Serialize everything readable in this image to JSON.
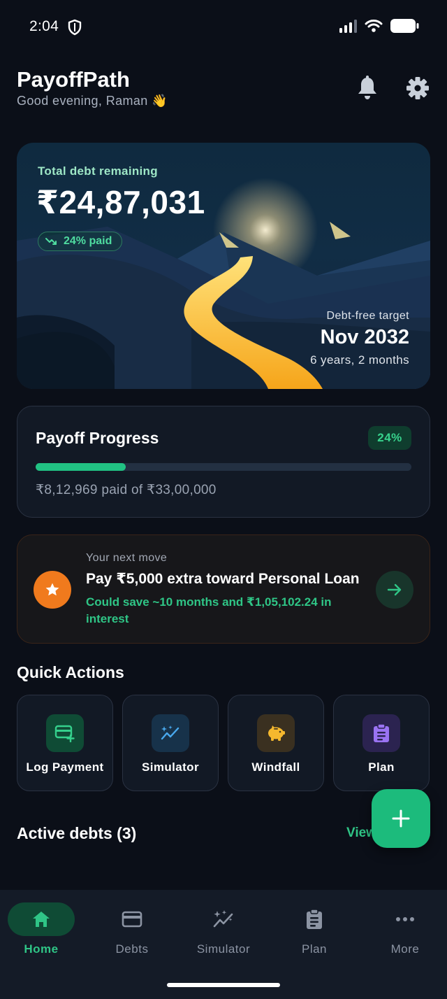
{
  "status_bar": {
    "time": "2:04"
  },
  "header": {
    "app_title": "PayoffPath",
    "greeting": "Good evening, Raman 👋"
  },
  "hero": {
    "label": "Total debt remaining",
    "amount": "₹24,87,031",
    "badge": "24% paid",
    "target_label": "Debt-free target",
    "target_date": "Nov 2032",
    "target_duration": "6 years, 2 months"
  },
  "progress": {
    "title": "Payoff Progress",
    "percent_label": "24%",
    "fraction": 0.24,
    "subtitle": "₹8,12,969 paid of ₹33,00,000"
  },
  "next_move": {
    "label": "Your next move",
    "title": "Pay ₹5,000 extra toward Personal Loan",
    "subtitle": "Could save ~10 months and ₹1,05,102.24 in interest"
  },
  "quick_actions": {
    "title": "Quick Actions",
    "items": [
      {
        "label": "Log Payment",
        "icon": "card-add-icon",
        "bg": "#0f4b35",
        "fg": "#35d08c"
      },
      {
        "label": "Simulator",
        "icon": "sparkle-chart-icon",
        "bg": "#17324a",
        "fg": "#49a9ee"
      },
      {
        "label": "Windfall",
        "icon": "piggy-bank-icon",
        "bg": "#3a3020",
        "fg": "#f5b82e"
      },
      {
        "label": "Plan",
        "icon": "clipboard-icon",
        "bg": "#2b2350",
        "fg": "#9a73f2"
      }
    ]
  },
  "active_debts": {
    "title": "Active debts (3)",
    "view_all": "View"
  },
  "bottom_nav": {
    "items": [
      {
        "label": "Home",
        "icon": "home-icon",
        "active": true
      },
      {
        "label": "Debts",
        "icon": "card-icon",
        "active": false
      },
      {
        "label": "Simulator",
        "icon": "sparkle-chart-icon",
        "active": false
      },
      {
        "label": "Plan",
        "icon": "clipboard-icon",
        "active": false
      },
      {
        "label": "More",
        "icon": "more-dots-icon",
        "active": false
      }
    ]
  },
  "colors": {
    "background": "#0b0f18",
    "accent_green": "#2fc586",
    "accent_orange": "#f07a1d",
    "card": "#121925"
  }
}
